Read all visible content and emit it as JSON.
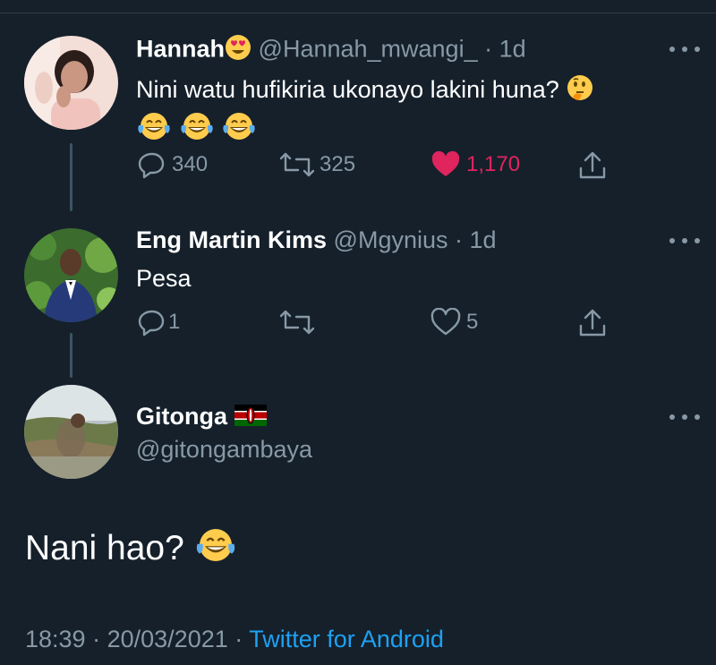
{
  "tweets": [
    {
      "name": "Hannah",
      "handle": "@Hannah_mwangi_",
      "separator": "·",
      "time": "1d",
      "text": "Nini watu hufikiria ukonayo lakini huna?",
      "name_emoji": "heart-eyes-emoji",
      "text_emojis": [
        "thinking-face-emoji",
        "tears-of-joy-emoji",
        "tears-of-joy-emoji",
        "tears-of-joy-emoji"
      ],
      "replies": "340",
      "retweets": "325",
      "likes": "1,170",
      "liked": true
    },
    {
      "name": "Eng Martin Kims",
      "handle": "@Mgynius",
      "separator": "·",
      "time": "1d",
      "text": "Pesa",
      "replies": "1",
      "retweets": "",
      "likes": "5",
      "liked": false
    }
  ],
  "main_tweet": {
    "name": "Gitonga",
    "handle": "@gitongambaya",
    "name_emoji": "kenya-flag-emoji",
    "text": "Nani hao?",
    "text_emoji": "tears-of-joy-emoji",
    "time": "18:39",
    "date": "20/03/2021",
    "separator": "·",
    "source": "Twitter for Android"
  },
  "colors": {
    "background": "#15202b",
    "secondary_text": "#8899a6",
    "like": "#e0245e",
    "link": "#1da1f2"
  }
}
